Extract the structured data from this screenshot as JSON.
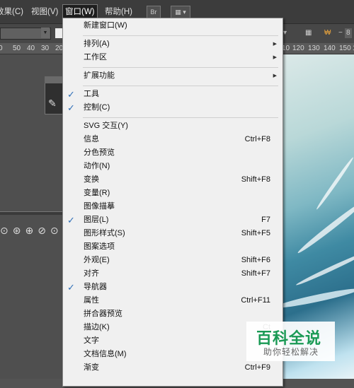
{
  "menubar": {
    "items": [
      "效果(C)",
      "视图(V)",
      "窗口(W)",
      "帮助(H)"
    ],
    "br_label": "Br"
  },
  "control_bar": {
    "right_value": "8",
    "right_prefix": "−"
  },
  "ruler": {
    "ticks": [
      "0",
      "50",
      "40",
      "30",
      "20",
      "10",
      "0",
      "10",
      "120",
      "130",
      "140",
      "150",
      "16"
    ]
  },
  "menu": {
    "new_window": "新建窗口(W)",
    "arrange": "排列(A)",
    "workspace": "工作区",
    "extensions": "扩展功能",
    "tools": "工具",
    "control": "控制(C)",
    "items": [
      {
        "label": "SVG 交互(Y)",
        "shortcut": "",
        "checked": false
      },
      {
        "label": "信息",
        "shortcut": "Ctrl+F8",
        "checked": false
      },
      {
        "label": "分色预览",
        "shortcut": "",
        "checked": false
      },
      {
        "label": "动作(N)",
        "shortcut": "",
        "checked": false
      },
      {
        "label": "变换",
        "shortcut": "Shift+F8",
        "checked": false
      },
      {
        "label": "变量(R)",
        "shortcut": "",
        "checked": false
      },
      {
        "label": "图像描摹",
        "shortcut": "",
        "checked": false
      },
      {
        "label": "图层(L)",
        "shortcut": "F7",
        "checked": true
      },
      {
        "label": "图形样式(S)",
        "shortcut": "Shift+F5",
        "checked": false
      },
      {
        "label": "图案选项",
        "shortcut": "",
        "checked": false
      },
      {
        "label": "外观(E)",
        "shortcut": "Shift+F6",
        "checked": false
      },
      {
        "label": "对齐",
        "shortcut": "Shift+F7",
        "checked": false
      },
      {
        "label": "导航器",
        "shortcut": "",
        "checked": true
      },
      {
        "label": "属性",
        "shortcut": "Ctrl+F11",
        "checked": false
      },
      {
        "label": "拼合器预览",
        "shortcut": "",
        "checked": false
      },
      {
        "label": "描边(K)",
        "shortcut": "Ct",
        "checked": false
      },
      {
        "label": "文字",
        "shortcut": "",
        "checked": false
      },
      {
        "label": "文档信息(M)",
        "shortcut": "",
        "checked": false
      },
      {
        "label": "渐变",
        "shortcut": "Ctrl+F9",
        "checked": false
      }
    ]
  },
  "watermark": {
    "title": "百科全说",
    "subtitle": "助你轻松解决"
  },
  "colors": {
    "check": "#2f6fb8",
    "watermark_green": "#1a9a55"
  }
}
